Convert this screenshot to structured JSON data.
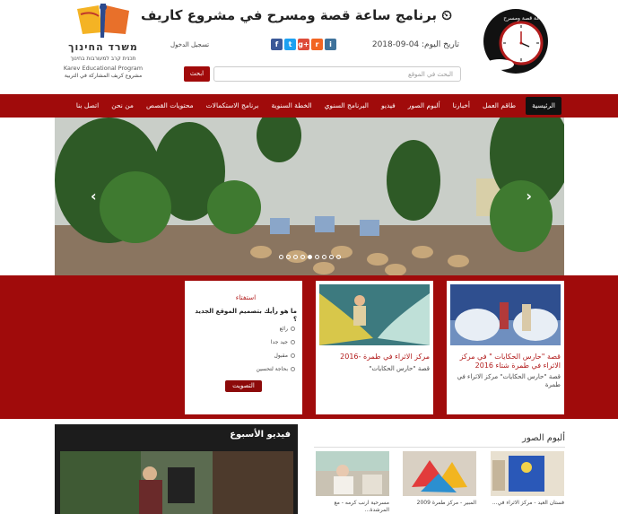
{
  "header": {
    "headline": "برنامج ساعة قصة ومسرح في مشروع كاريف",
    "date": "تاريخ اليوم: 04-09-2018",
    "login": "تسجيل الدخول",
    "search_placeholder": "البحث في الموقع",
    "search_button": "ابحث",
    "logo_text": "ساعة قصة ومسرح"
  },
  "ministry": {
    "hebrew_title": "משרד החינוך",
    "hebrew_sub": "תכנית קרב למעורבות בחינוך",
    "english": "Karev Educational Program",
    "arabic": "مشروع كريف المشاركة في التربية"
  },
  "social": [
    {
      "icon": "facebook-icon",
      "glyph": "f",
      "color": "#3b5998"
    },
    {
      "icon": "twitter-icon",
      "glyph": "t",
      "color": "#1da1f2"
    },
    {
      "icon": "google-plus-icon",
      "glyph": "g+",
      "color": "#dd4b39"
    },
    {
      "icon": "rss-icon",
      "glyph": "r",
      "color": "#f26522"
    },
    {
      "icon": "instagram-icon",
      "glyph": "i",
      "color": "#3f729b"
    }
  ],
  "nav": [
    "الرئيسية",
    "طاقم العمل",
    "أخبارنا",
    "ألبوم الصور",
    "فيديو",
    "البرنامج السنوي",
    "الخطة السنوية",
    "برنامج الاستكمالات",
    "محتويات القصص",
    "من نحن",
    "اتصل بنا"
  ],
  "slider": {
    "slides": 9,
    "active": 4
  },
  "cards": [
    {
      "title": "قصة \"حارس الحكايات \" في مركز الاثراء في طمرة شتاء 2016",
      "sub": "قصة \"حارس الحكايات\" مركز الاثراء في طمرة"
    },
    {
      "title": "مركز الاثراء في طمرة -2016",
      "sub": "قصة \"حارس الحكايات\""
    }
  ],
  "poll": {
    "heading": "استفتاء",
    "question": "ما هو رأيك بتصميم الموقع الجديد ؟",
    "options": [
      "رائع",
      "جيد جدا",
      "مقبول",
      "بحاجة لتحسين"
    ],
    "vote": "التصويت"
  },
  "video": {
    "heading": "فيديو الأسبوع"
  },
  "album": {
    "heading": "ألبوم الصور",
    "items": [
      {
        "caption": "فستان العيد - مركز الاثراء في..."
      },
      {
        "caption": "المبير - مركز طمرة 2009"
      },
      {
        "caption": "مسرحية ارنب كرمه - مع المرشدة..."
      }
    ]
  }
}
